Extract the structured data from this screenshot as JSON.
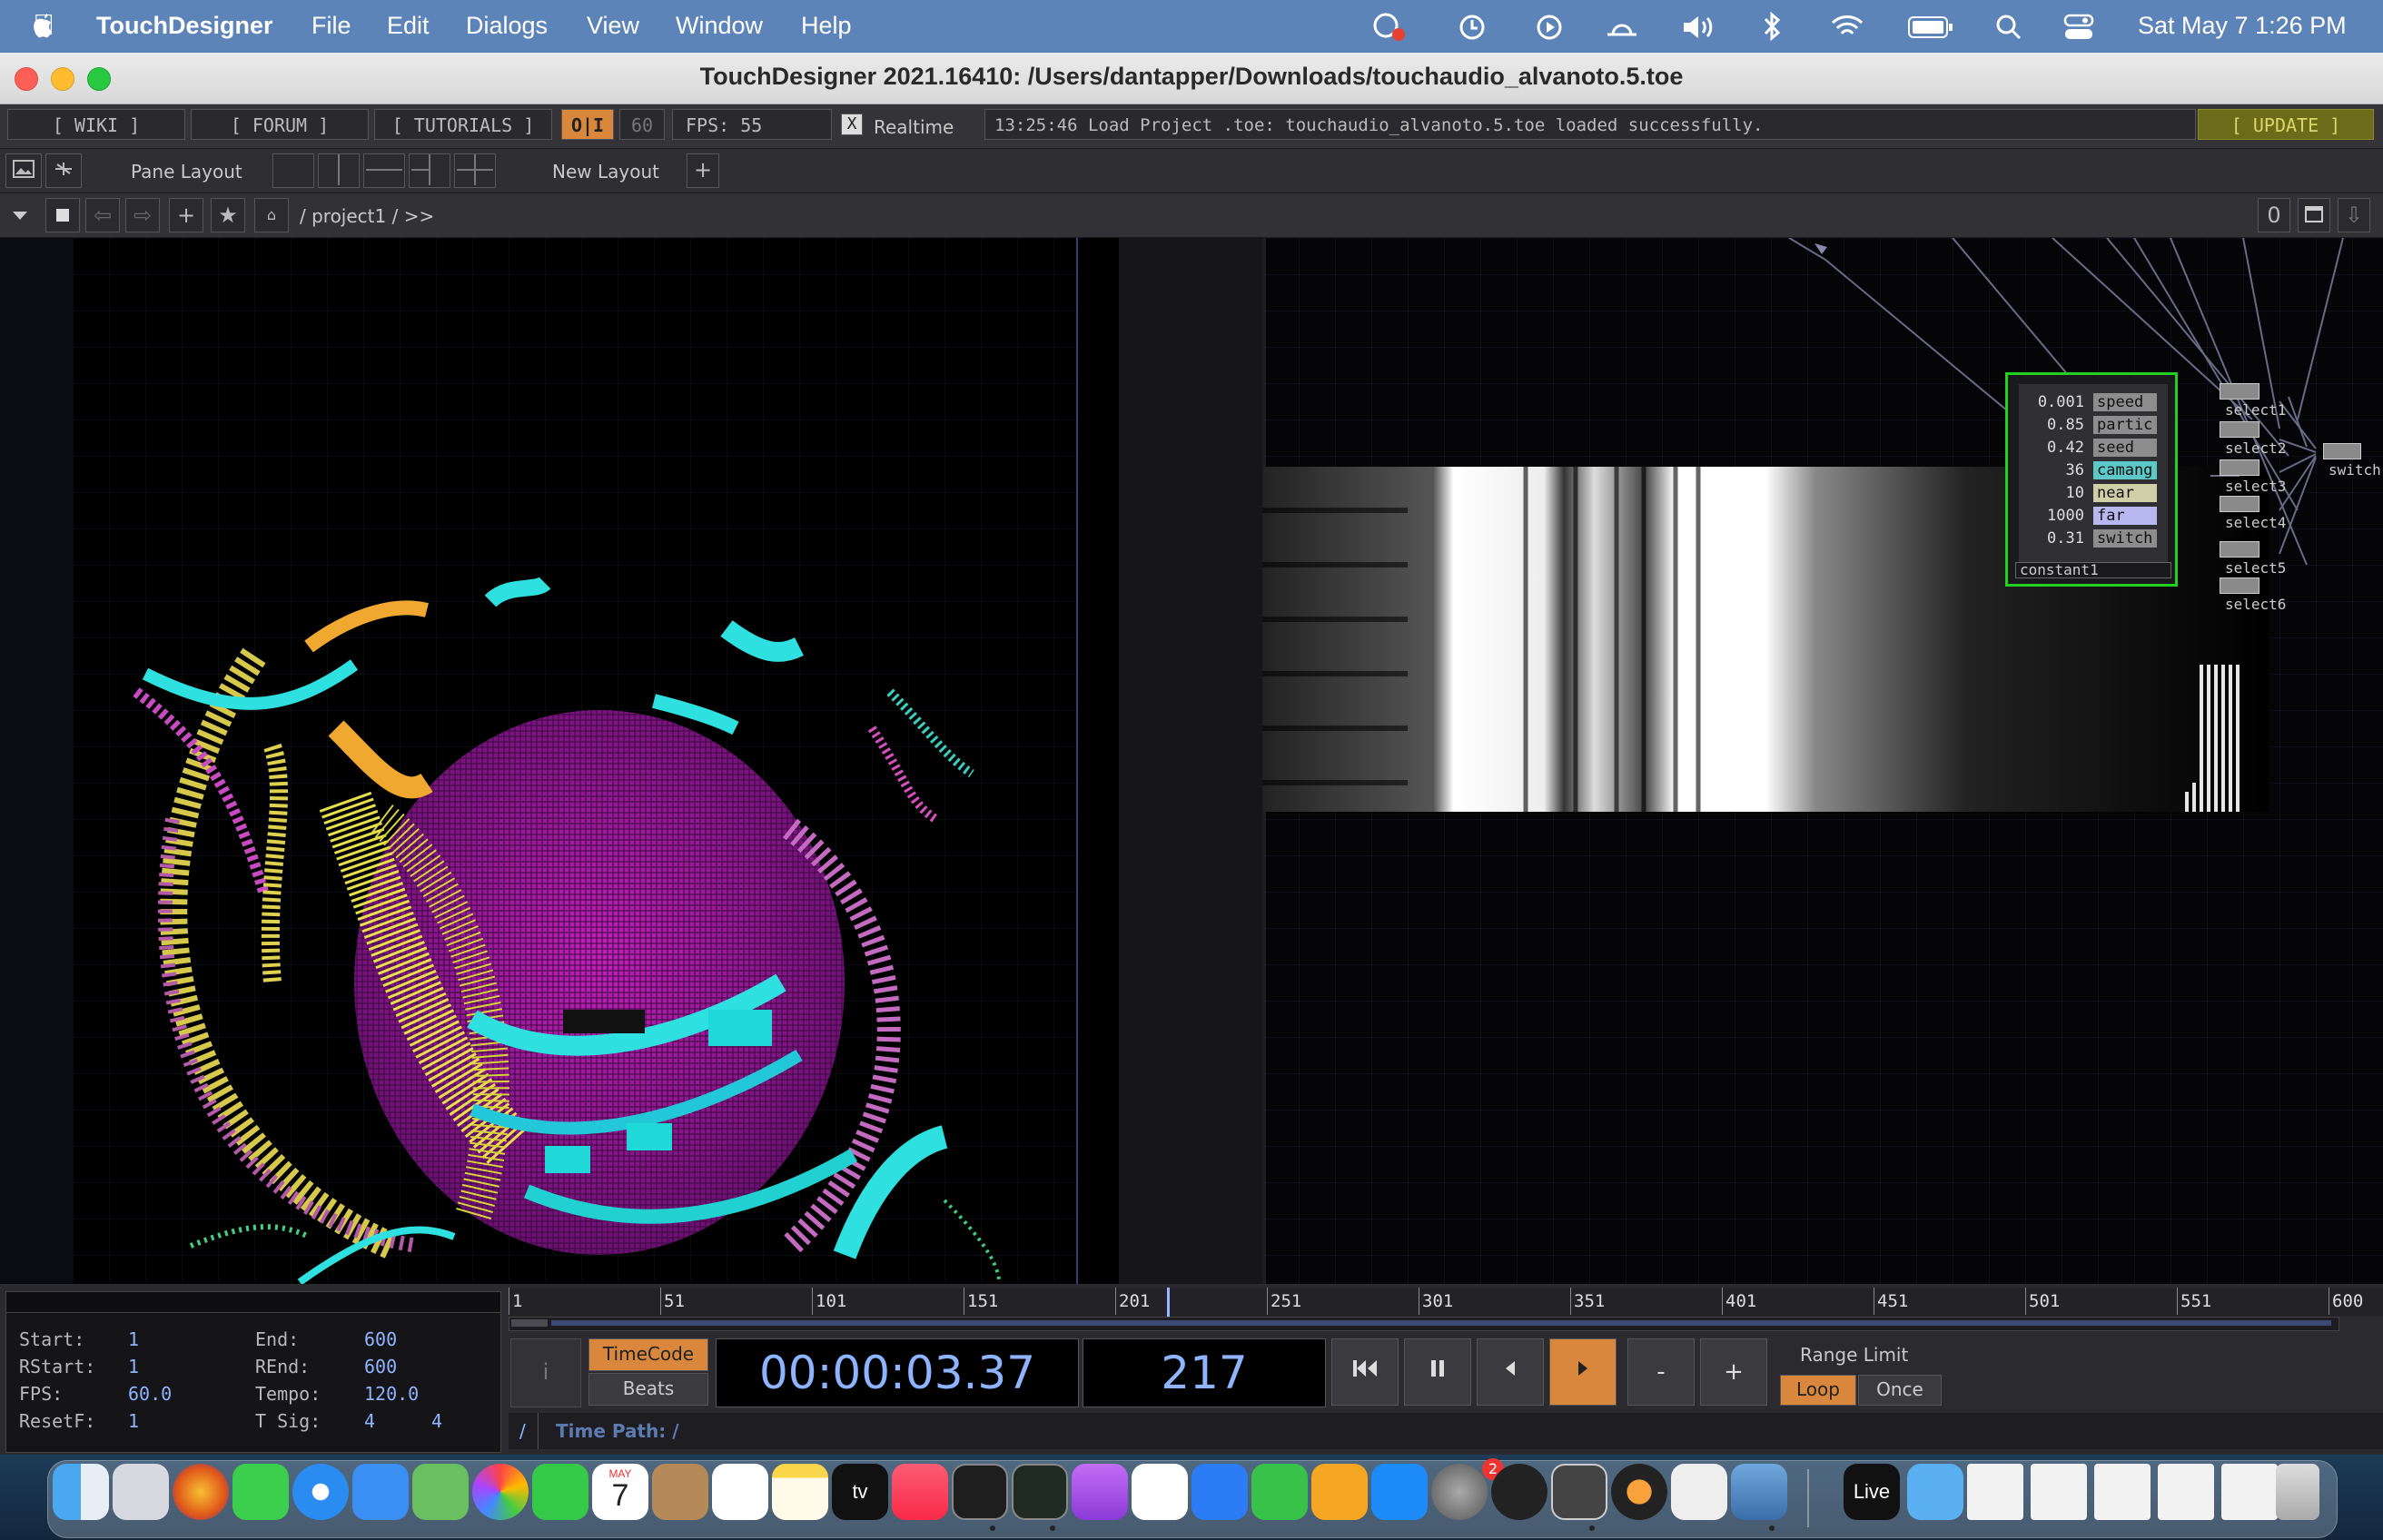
{
  "menubar": {
    "app": "TouchDesigner",
    "items": [
      "File",
      "Edit",
      "Dialogs",
      "View",
      "Window",
      "Help"
    ],
    "clock": "Sat May 7  1:26 PM"
  },
  "window": {
    "title": "TouchDesigner 2021.16410: /Users/dantapper/Downloads/touchaudio_alvanoto.5.toe"
  },
  "toolbar": {
    "wiki": "[ WIKI ]",
    "forum": "[ FORUM ]",
    "tutorials": "[ TUTORIALS ]",
    "oi": "O|I",
    "fps_cap": "60",
    "fps": "FPS:  55",
    "realtime_checkbox": "X",
    "realtime": "Realtime",
    "status": "13:25:46 Load Project .toe: touchaudio_alvanoto.5.toe loaded successfully.",
    "update": "[ UPDATE ]"
  },
  "layoutbar": {
    "pane_layout": "Pane Layout",
    "new_layout": "New Layout",
    "plus": "+"
  },
  "pathbar": {
    "path": "/ project1  / >>",
    "counter": "0"
  },
  "node": {
    "name": "constant1",
    "params": [
      {
        "value": "0.001",
        "name": "speed"
      },
      {
        "value": "0.85",
        "name": "partic"
      },
      {
        "value": "0.42",
        "name": "seed"
      },
      {
        "value": "36",
        "name": "camang"
      },
      {
        "value": "10",
        "name": "near"
      },
      {
        "value": "1000",
        "name": "far"
      },
      {
        "value": "0.31",
        "name": "switch"
      }
    ],
    "selects": [
      "select1",
      "select2",
      "select3",
      "select4",
      "select5",
      "select6"
    ],
    "switch_label": "switch"
  },
  "range": {
    "start_label": "Start:",
    "start": "1",
    "rstart_label": "RStart:",
    "rstart": "1",
    "fps_label": "FPS:",
    "fps": "60.0",
    "resetf_label": "ResetF:",
    "resetf": "1",
    "end_label": "End:",
    "end": "600",
    "rend_label": "REnd:",
    "rend": "600",
    "tempo_label": "Tempo:",
    "tempo": "120.0",
    "tsig_label": "T Sig:",
    "tsig_a": "4",
    "tsig_b": "4"
  },
  "timeline": {
    "ticks": [
      "1",
      "51",
      "101",
      "151",
      "201",
      "251",
      "301",
      "351",
      "401",
      "451",
      "501",
      "551",
      "600"
    ],
    "current_frame_fraction": 0.362,
    "timecode_btn": "TimeCode",
    "beats_btn": "Beats",
    "timecode": "00:00:03.37",
    "frame": "217",
    "range_limit": "Range Limit",
    "loop": "Loop",
    "once": "Once",
    "minus": "-",
    "plus": "+",
    "time_path_slash": "/",
    "time_path": "Time Path: /"
  },
  "dock": {
    "calendar_month": "MAY",
    "calendar_day": "7",
    "tv_label": "tv",
    "live_label": "Live",
    "badge": "2"
  },
  "colors": {
    "menubar": "#5d84b8",
    "accent_orange": "#d9873c",
    "node_outline": "#22d022",
    "timecode_text": "#8fb4ff"
  }
}
